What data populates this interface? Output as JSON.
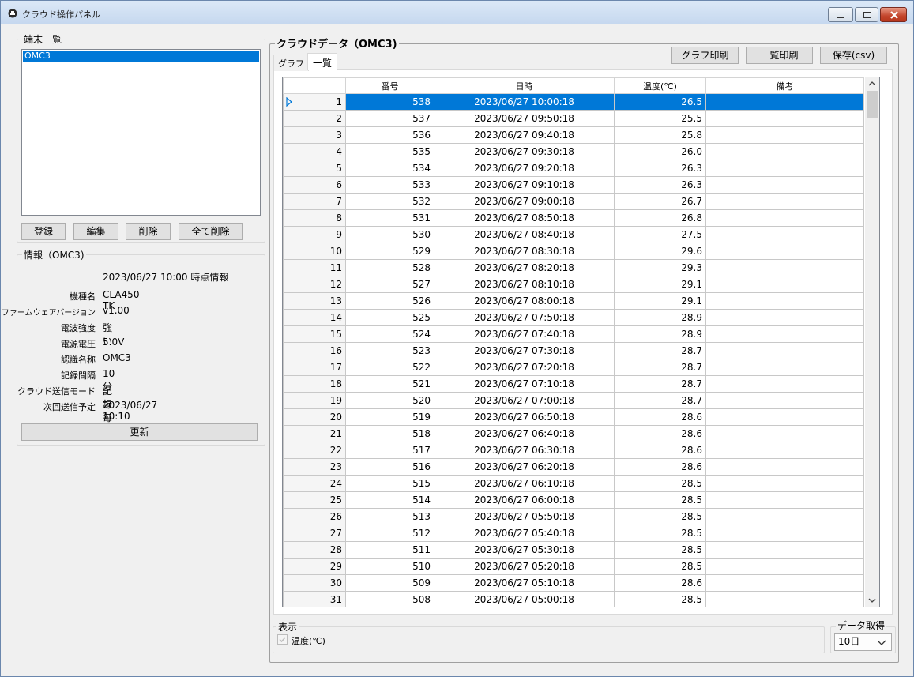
{
  "window": {
    "title": "クラウド操作パネル"
  },
  "device_list": {
    "label": "端末一覧",
    "items": [
      "OMC3"
    ],
    "buttons": {
      "register": "登録",
      "edit": "編集",
      "delete": "削除",
      "delete_all": "全て削除"
    }
  },
  "info": {
    "label": "情報（OMC3)",
    "timestamp_note": "2023/06/27 10:00 時点情報",
    "fields": [
      {
        "label": "機種名",
        "value": "CLA450-TK"
      },
      {
        "label": "ファームウェアバージョン",
        "value": "v1.00"
      },
      {
        "label": "電波強度",
        "value": "強い"
      },
      {
        "label": "電源電圧",
        "value": "5.0V"
      },
      {
        "label": "認識名称",
        "value": "OMC3"
      },
      {
        "label": "記録間隔",
        "value": "10分"
      },
      {
        "label": "クラウド送信モード",
        "value": "記録毎"
      },
      {
        "label": "次回送信予定",
        "value": "2023/06/27 10:10"
      }
    ],
    "update_button": "更新"
  },
  "cloud": {
    "title": "クラウドデータ（OMC3)",
    "tabs": [
      "グラフ",
      "一覧"
    ],
    "buttons": {
      "print_graph": "グラフ印刷",
      "print_list": "一覧印刷",
      "save_csv": "保存(csv)"
    }
  },
  "table": {
    "columns": [
      "番号",
      "日時",
      "温度(℃)",
      "備考"
    ],
    "rows": [
      [
        "1",
        "538",
        "2023/06/27 10:00:18",
        "26.5",
        ""
      ],
      [
        "2",
        "537",
        "2023/06/27 09:50:18",
        "25.5",
        ""
      ],
      [
        "3",
        "536",
        "2023/06/27 09:40:18",
        "25.8",
        ""
      ],
      [
        "4",
        "535",
        "2023/06/27 09:30:18",
        "26.0",
        ""
      ],
      [
        "5",
        "534",
        "2023/06/27 09:20:18",
        "26.3",
        ""
      ],
      [
        "6",
        "533",
        "2023/06/27 09:10:18",
        "26.3",
        ""
      ],
      [
        "7",
        "532",
        "2023/06/27 09:00:18",
        "26.7",
        ""
      ],
      [
        "8",
        "531",
        "2023/06/27 08:50:18",
        "26.8",
        ""
      ],
      [
        "9",
        "530",
        "2023/06/27 08:40:18",
        "27.5",
        ""
      ],
      [
        "10",
        "529",
        "2023/06/27 08:30:18",
        "29.6",
        ""
      ],
      [
        "11",
        "528",
        "2023/06/27 08:20:18",
        "29.3",
        ""
      ],
      [
        "12",
        "527",
        "2023/06/27 08:10:18",
        "29.1",
        ""
      ],
      [
        "13",
        "526",
        "2023/06/27 08:00:18",
        "29.1",
        ""
      ],
      [
        "14",
        "525",
        "2023/06/27 07:50:18",
        "28.9",
        ""
      ],
      [
        "15",
        "524",
        "2023/06/27 07:40:18",
        "28.9",
        ""
      ],
      [
        "16",
        "523",
        "2023/06/27 07:30:18",
        "28.7",
        ""
      ],
      [
        "17",
        "522",
        "2023/06/27 07:20:18",
        "28.7",
        ""
      ],
      [
        "18",
        "521",
        "2023/06/27 07:10:18",
        "28.7",
        ""
      ],
      [
        "19",
        "520",
        "2023/06/27 07:00:18",
        "28.7",
        ""
      ],
      [
        "20",
        "519",
        "2023/06/27 06:50:18",
        "28.6",
        ""
      ],
      [
        "21",
        "518",
        "2023/06/27 06:40:18",
        "28.6",
        ""
      ],
      [
        "22",
        "517",
        "2023/06/27 06:30:18",
        "28.6",
        ""
      ],
      [
        "23",
        "516",
        "2023/06/27 06:20:18",
        "28.6",
        ""
      ],
      [
        "24",
        "515",
        "2023/06/27 06:10:18",
        "28.5",
        ""
      ],
      [
        "25",
        "514",
        "2023/06/27 06:00:18",
        "28.5",
        ""
      ],
      [
        "26",
        "513",
        "2023/06/27 05:50:18",
        "28.5",
        ""
      ],
      [
        "27",
        "512",
        "2023/06/27 05:40:18",
        "28.5",
        ""
      ],
      [
        "28",
        "511",
        "2023/06/27 05:30:18",
        "28.5",
        ""
      ],
      [
        "29",
        "510",
        "2023/06/27 05:20:18",
        "28.5",
        ""
      ],
      [
        "30",
        "509",
        "2023/06/27 05:10:18",
        "28.6",
        ""
      ],
      [
        "31",
        "508",
        "2023/06/27 05:00:18",
        "28.5",
        ""
      ]
    ],
    "selected_row": 0
  },
  "display": {
    "label": "表示",
    "checkbox_label": "温度(℃)"
  },
  "data_fetch": {
    "label": "データ取得",
    "selected": "10日"
  },
  "colors": {
    "selection": "#0078d7",
    "titlebar": "#c6d8ef",
    "close_button": "#c3452c"
  }
}
